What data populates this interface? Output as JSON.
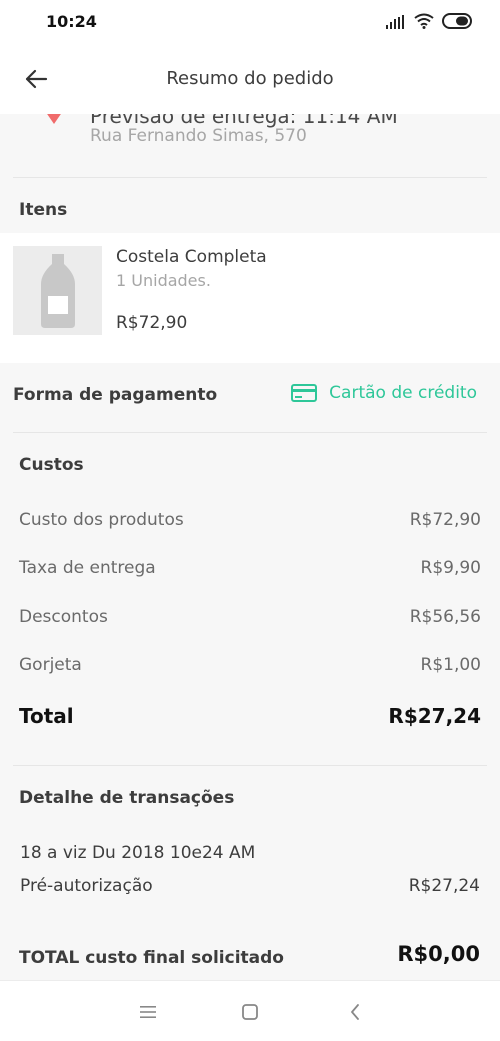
{
  "status_bar": {
    "time": "10:24"
  },
  "header": {
    "title": "Resumo do pedido"
  },
  "delivery": {
    "eta": "Previsão de entrega: 11:14 AM",
    "address": "Rua Fernando Simas, 570",
    "pin_color": "#f06b6b"
  },
  "items_section": {
    "title": "Itens"
  },
  "items": [
    {
      "name": "Costela Completa",
      "quantity": "1 Unidades.",
      "price": "R$72,90"
    }
  ],
  "payment": {
    "label": "Forma de pagamento",
    "method": "Cartão de crédito",
    "method_icon": "credit-card-icon",
    "accent_color": "#2ec799"
  },
  "costs": {
    "title": "Custos",
    "rows": [
      {
        "label": "Custo dos produtos",
        "value": "R$72,90"
      },
      {
        "label": "Taxa de entrega",
        "value": "R$9,90"
      },
      {
        "label": "Descontos",
        "value": "R$56,56"
      },
      {
        "label": "Gorjeta",
        "value": "R$1,00"
      }
    ],
    "total_label": "Total",
    "total_value": "R$27,24"
  },
  "transactions": {
    "title": "Detalhe de transações",
    "date": "18 a viz Du 2018 10e24 AM",
    "row_label": "Pré-autorização",
    "row_value": "R$27,24"
  },
  "final": {
    "label": "TOTAL custo final solicitado",
    "value": "R$0,00"
  },
  "nav": {
    "icons": [
      "menu-icon",
      "home-square-icon",
      "back-chevron-icon"
    ]
  }
}
